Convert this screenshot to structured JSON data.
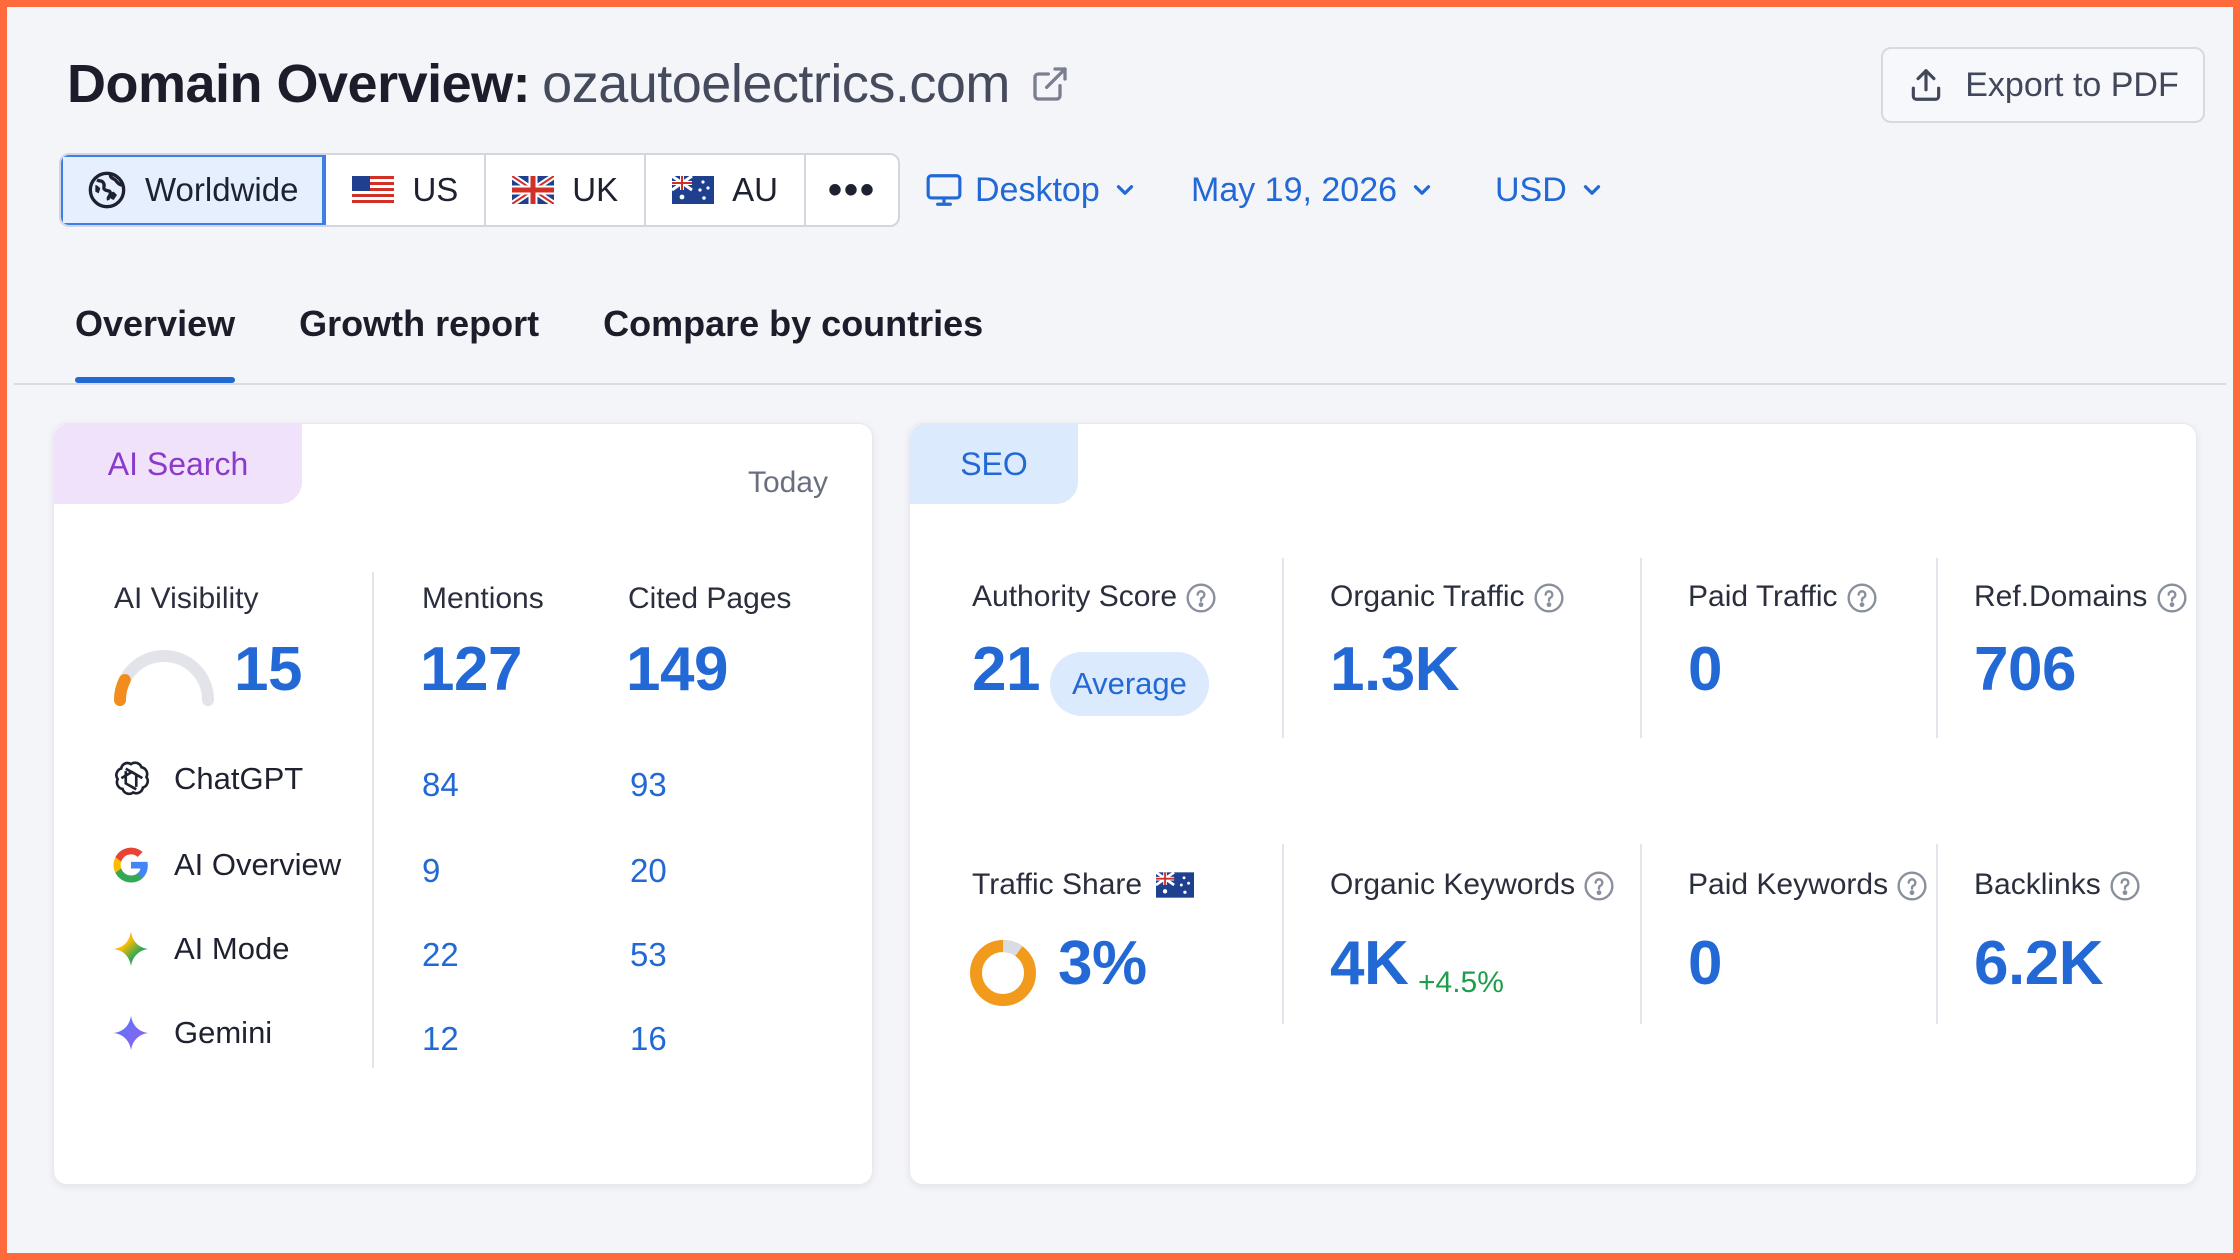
{
  "header": {
    "title_prefix": "Domain Overview:",
    "domain": "ozautoelectrics.com",
    "export_label": "Export to PDF"
  },
  "regions": [
    {
      "label": "Worldwide",
      "icon": "globe-icon",
      "active": true
    },
    {
      "label": "US",
      "icon": "flag-us-icon",
      "active": false
    },
    {
      "label": "UK",
      "icon": "flag-uk-icon",
      "active": false
    },
    {
      "label": "AU",
      "icon": "flag-au-icon",
      "active": false
    }
  ],
  "more_label": "•••",
  "filters": {
    "device": "Desktop",
    "date": "May 19, 2026",
    "currency": "USD"
  },
  "tabs": [
    "Overview",
    "Growth report",
    "Compare by countries"
  ],
  "ai_search": {
    "tab_label": "AI Search",
    "period": "Today",
    "visibility_label": "AI Visibility",
    "visibility_value": "15",
    "visibility_fraction": 0.15,
    "mentions_label": "Mentions",
    "mentions_total": "127",
    "cited_label": "Cited Pages",
    "cited_total": "149",
    "rows": [
      {
        "name": "ChatGPT",
        "icon": "chatgpt-icon",
        "mentions": "84",
        "cited": "93"
      },
      {
        "name": "AI Overview",
        "icon": "google-icon",
        "mentions": "9",
        "cited": "20"
      },
      {
        "name": "AI Mode",
        "icon": "ai-mode-icon",
        "mentions": "22",
        "cited": "53"
      },
      {
        "name": "Gemini",
        "icon": "gemini-icon",
        "mentions": "12",
        "cited": "16"
      }
    ]
  },
  "seo": {
    "tab_label": "SEO",
    "authority_label": "Authority Score",
    "authority_value": "21",
    "authority_badge": "Average",
    "organic_traffic_label": "Organic Traffic",
    "organic_traffic_value": "1.3K",
    "paid_traffic_label": "Paid Traffic",
    "paid_traffic_value": "0",
    "ref_domains_label": "Ref.Domains",
    "ref_domains_value": "706",
    "traffic_share_label": "Traffic Share",
    "traffic_share_value": "3%",
    "traffic_share_fraction": 0.03,
    "organic_keywords_label": "Organic Keywords",
    "organic_keywords_value": "4K",
    "organic_keywords_change": "+4.5%",
    "paid_keywords_label": "Paid Keywords",
    "paid_keywords_value": "0",
    "backlinks_label": "Backlinks",
    "backlinks_value": "6.2K"
  },
  "colors": {
    "accent": "#2369d6",
    "frame": "#ff6a3d",
    "ai_tab_bg": "#f1e2fb",
    "ai_tab_text": "#8a3bc9",
    "seo_tab_bg": "#dbeafd",
    "positive": "#1e9e4a",
    "gauge_orange": "#f28c1c"
  }
}
